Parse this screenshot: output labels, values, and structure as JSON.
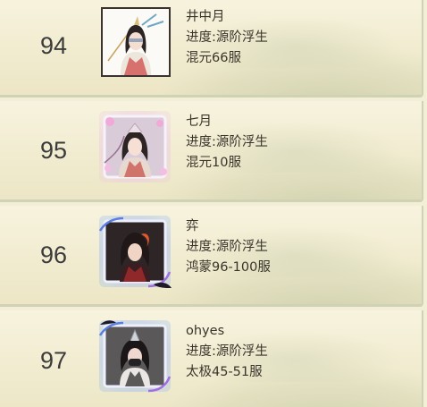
{
  "players": [
    {
      "rank": "94",
      "name": "井中月",
      "progress": "进度:源阶浮生",
      "server": "混元66服",
      "frame": "plain"
    },
    {
      "rank": "95",
      "name": "七月",
      "progress": "进度:源阶浮生",
      "server": "混元10服",
      "frame": "blossom"
    },
    {
      "rank": "96",
      "name": "弈",
      "progress": "进度:源阶浮生",
      "server": "鸿蒙96-100服",
      "frame": "spirit"
    },
    {
      "rank": "97",
      "name": "ohyes",
      "progress": "进度:源阶浮生",
      "server": "太极45-51服",
      "frame": "spirit"
    }
  ]
}
